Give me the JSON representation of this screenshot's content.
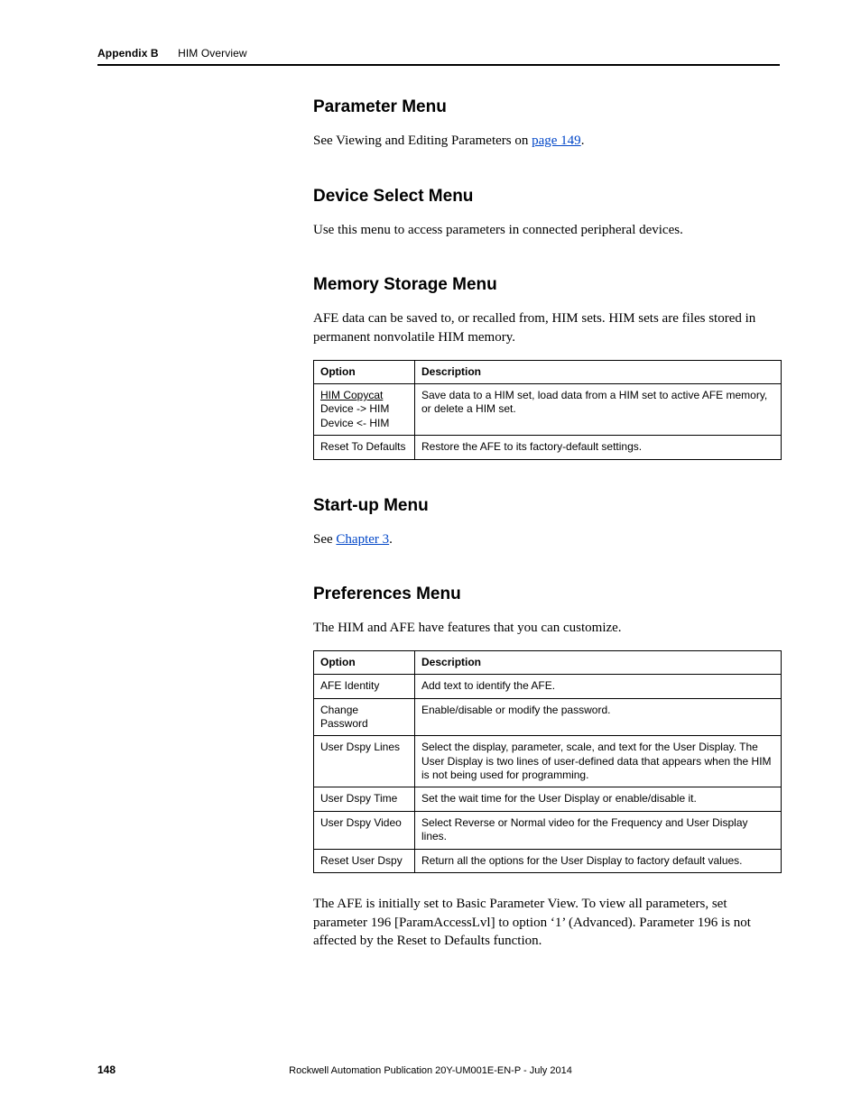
{
  "header": {
    "appendix": "Appendix B",
    "title": "HIM Overview"
  },
  "s1": {
    "h": "Parameter Menu",
    "p1a": "See Viewing and Editing Parameters on ",
    "p1link": "page 149",
    "p1b": "."
  },
  "s2": {
    "h": "Device Select Menu",
    "p": "Use this menu to access parameters in connected peripheral devices."
  },
  "s3": {
    "h": "Memory Storage Menu",
    "p": "AFE data can be saved to, or recalled from, HIM sets. HIM sets are files stored in permanent nonvolatile HIM memory.",
    "th1": "Option",
    "th2": "Description",
    "r1c1a": "HIM Copycat",
    "r1c1b": "Device -> HIM",
    "r1c1c": "Device <- HIM",
    "r1c2": "Save data to a HIM set, load data from a HIM set to active AFE memory, or delete a HIM set.",
    "r2c1": "Reset To Defaults",
    "r2c2": "Restore the AFE to its factory-default settings."
  },
  "s4": {
    "h": "Start-up Menu",
    "p1a": "See ",
    "p1link": "Chapter 3",
    "p1b": "."
  },
  "s5": {
    "h": "Preferences Menu",
    "p": "The HIM and AFE have features that you can customize.",
    "th1": "Option",
    "th2": "Description",
    "rows": [
      {
        "c1": "AFE Identity",
        "c2": "Add text to identify the AFE."
      },
      {
        "c1": "Change Password",
        "c2": "Enable/disable or modify the password."
      },
      {
        "c1": "User Dspy Lines",
        "c2": "Select the display, parameter, scale, and text for the User Display. The User Display is two lines of user-defined data that appears when the HIM is not being used for programming."
      },
      {
        "c1": "User Dspy Time",
        "c2": "Set the wait time for the User Display or enable/disable it."
      },
      {
        "c1": "User Dspy Video",
        "c2": "Select Reverse or Normal video for the Frequency and User Display lines."
      },
      {
        "c1": "Reset User Dspy",
        "c2": "Return all the options for the User Display to factory default values."
      }
    ],
    "note": "The AFE is initially set to Basic Parameter View. To view all parameters, set parameter 196 [ParamAccessLvl] to option ‘1’ (Advanced). Parameter 196 is not affected by the Reset to Defaults function."
  },
  "footer": {
    "page": "148",
    "pub": "Rockwell Automation Publication 20Y-UM001E-EN-P - July 2014"
  }
}
